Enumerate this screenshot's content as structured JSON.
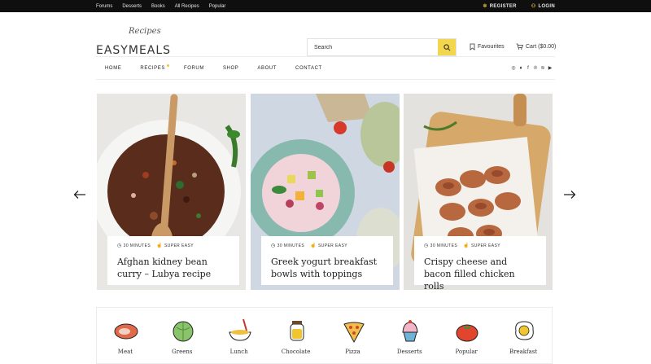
{
  "topbar": {
    "links": [
      "Forums",
      "Desserts",
      "Books",
      "All Recipes",
      "Popular"
    ],
    "register": "REGISTER",
    "login": "LOGIN"
  },
  "logo": {
    "script": "Recipes",
    "main": "EASYMEALS"
  },
  "search": {
    "placeholder": "Search",
    "icon": "search-icon"
  },
  "header": {
    "favourites": "Favourites",
    "cart": "Cart ($0.00)"
  },
  "nav": {
    "items": [
      "HOME",
      "RECIPES",
      "FORUM",
      "SHOP",
      "ABOUT",
      "CONTACT"
    ],
    "social": [
      "instagram-icon",
      "twitter-icon",
      "facebook-icon",
      "pinterest-icon",
      "rss-icon",
      "youtube-icon"
    ]
  },
  "cards": [
    {
      "time": "30 MINUTES",
      "difficulty": "SUPER EASY",
      "title": "Afghan kidney bean curry – Lubya recipe"
    },
    {
      "time": "30 MINUTES",
      "difficulty": "SUPER EASY",
      "title": "Greek yogurt breakfast bowls with toppings"
    },
    {
      "time": "30 MINUTES",
      "difficulty": "SUPER EASY",
      "title": "Crispy cheese and bacon filled chicken rolls"
    }
  ],
  "categories": [
    {
      "label": "Meat",
      "icon": "meat-icon"
    },
    {
      "label": "Greens",
      "icon": "cabbage-icon"
    },
    {
      "label": "Lunch",
      "icon": "soup-bowl-icon"
    },
    {
      "label": "Chocolate",
      "icon": "chocolate-jar-icon"
    },
    {
      "label": "Pizza",
      "icon": "pizza-icon"
    },
    {
      "label": "Desserts",
      "icon": "cupcake-icon"
    },
    {
      "label": "Popular",
      "icon": "tomato-icon"
    },
    {
      "label": "Breakfast",
      "icon": "fried-egg-icon"
    }
  ],
  "colors": {
    "accent": "#f2d64b",
    "topbar": "#0f0f0f"
  }
}
